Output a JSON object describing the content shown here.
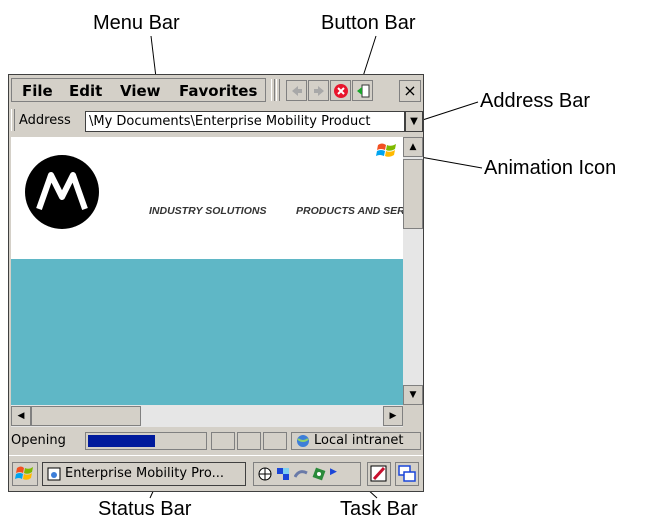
{
  "callouts": {
    "menu_bar": "Menu Bar",
    "button_bar": "Button Bar",
    "address_bar": "Address Bar",
    "animation_icon": "Animation Icon",
    "status_bar": "Status Bar",
    "task_bar": "Task Bar"
  },
  "menu": {
    "file": "File",
    "edit": "Edit",
    "view": "View",
    "favorites": "Favorites"
  },
  "close_glyph": "×",
  "address": {
    "label": "Address",
    "value": "\\My Documents\\Enterprise Mobility Product"
  },
  "page": {
    "nav_1": "INDUSTRY SOLUTIONS",
    "nav_2": "PRODUCTS AND SER"
  },
  "status": {
    "text": "Opening",
    "zone": "Local intranet",
    "progress_fraction": 0.58
  },
  "taskbar": {
    "window_label": "Enterprise Mobility Pro..."
  },
  "colors": {
    "banner": "#5fb7c6",
    "progress": "#001a9c",
    "chrome": "#d4d0c8"
  }
}
